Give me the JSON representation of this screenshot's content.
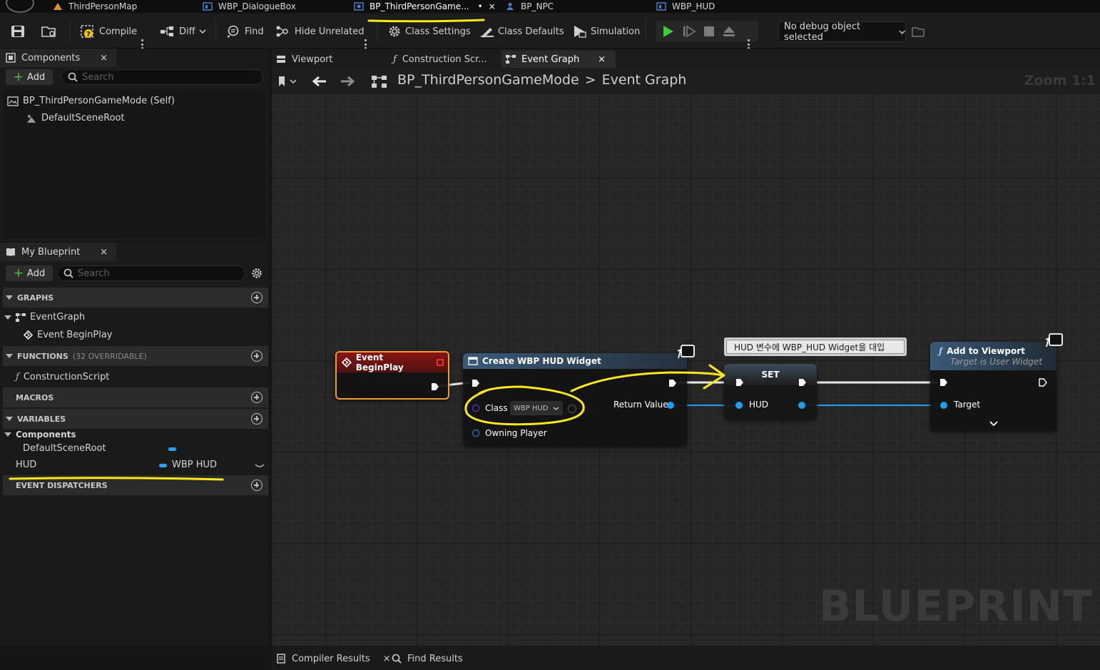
{
  "doc_tabs": [
    {
      "label": "ThirdPersonMap",
      "icon": "level-icon"
    },
    {
      "label": "WBP_DialogueBox",
      "icon": "widget-blueprint-icon"
    },
    {
      "label": "BP_ThirdPersonGame...",
      "modified": "•",
      "close": "×",
      "icon": "blueprint-icon"
    },
    {
      "label": "BP_NPC",
      "icon": "pawn-icon"
    },
    {
      "label": "WBP_HUD",
      "icon": "widget-blueprint-icon"
    }
  ],
  "toolbar": {
    "compile": "Compile",
    "diff": "Diff",
    "find": "Find",
    "hide_unrelated": "Hide Unrelated",
    "class_settings": "Class Settings",
    "class_defaults": "Class Defaults",
    "simulation": "Simulation",
    "debug_object": "No debug object selected"
  },
  "components_panel": {
    "tab_label": "Components",
    "close": "×",
    "add_label": "Add",
    "search_placeholder": "Search",
    "root_item": "BP_ThirdPersonGameMode (Self)",
    "child_item": "DefaultSceneRoot"
  },
  "my_blueprint": {
    "tab_label": "My Blueprint",
    "close": "×",
    "add_label": "Add",
    "search_placeholder": "Search",
    "graphs_header": "GRAPHS",
    "event_graph": "EventGraph",
    "event_begin_play": "Event BeginPlay",
    "functions_header": "FUNCTIONS",
    "functions_sub": "(32 OVERRIDABLE)",
    "construction_script": "ConstructionScript",
    "macros_header": "MACROS",
    "variables_header": "VARIABLES",
    "components_category": "Components",
    "variables": [
      {
        "name": "DefaultSceneRoot",
        "type": ""
      },
      {
        "name": "HUD",
        "type": "WBP HUD"
      }
    ],
    "dispatchers_header": "EVENT DISPATCHERS"
  },
  "graph_tabs": [
    {
      "label": "Viewport"
    },
    {
      "label": "Construction Scr..."
    },
    {
      "label": "Event Graph",
      "close": "×"
    }
  ],
  "breadcrumb": {
    "blueprint": "BP_ThirdPersonGameMode",
    "separator": ">",
    "graph": "Event Graph",
    "zoom": "Zoom 1:1"
  },
  "nodes": {
    "begin_play": {
      "title": "Event BeginPlay"
    },
    "create_widget": {
      "title": "Create WBP HUD Widget",
      "class_label": "Class",
      "class_value": "WBP HUD",
      "owning_player": "Owning Player",
      "return_value": "Return Value"
    },
    "set_node": {
      "title": "SET",
      "pin": "HUD"
    },
    "comment": "HUD 변수에 WBP_HUD Widget을 대입",
    "add_to_viewport": {
      "title": "Add to Viewport",
      "subtitle": "Target is User Widget",
      "target": "Target"
    }
  },
  "watermark": "BLUEPRINT",
  "bottom_tabs": [
    {
      "label": "Compiler Results",
      "close": "×"
    },
    {
      "label": "Find Results"
    }
  ],
  "colors": {
    "accent_yellow": "#ffe81a",
    "event_node_header": "#8a1414",
    "function_node_header": "#3a5a78",
    "var_pin_blue": "#1e9cf0",
    "play_green": "#3fcb3f"
  }
}
